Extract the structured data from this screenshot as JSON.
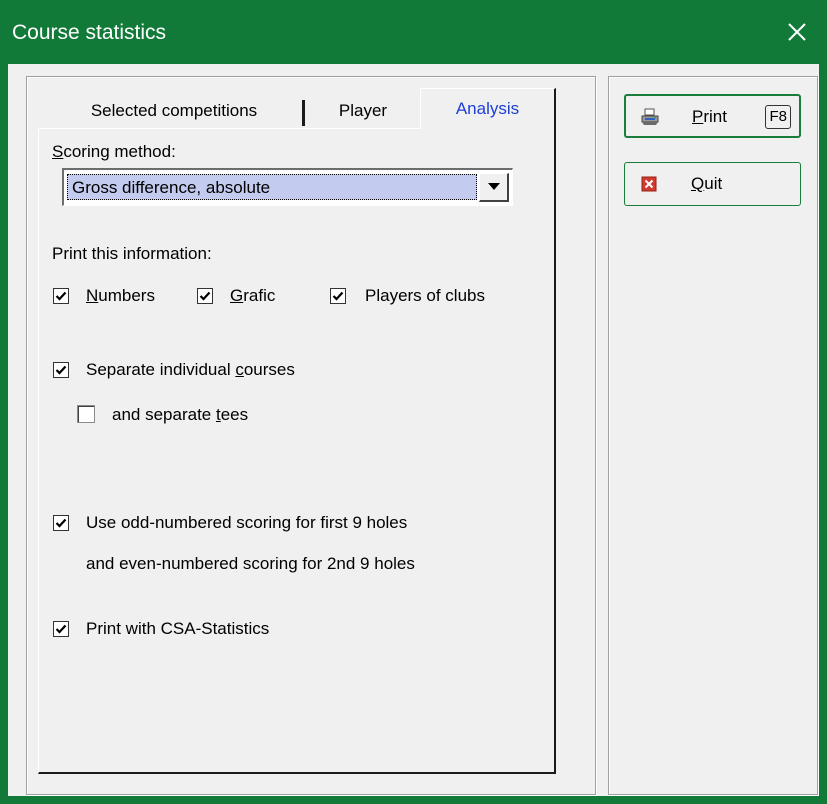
{
  "window": {
    "title": "Course statistics",
    "accent": "#117a38"
  },
  "tabs": {
    "selected_competitions": "Selected competitions",
    "player": "Player",
    "analysis": "Analysis"
  },
  "scoring": {
    "label_prefix": "",
    "label_mnemonic": "S",
    "label_rest": "coring method:",
    "selected_value": "Gross difference, absolute"
  },
  "print_info": {
    "heading": "Print this information:",
    "numbers": {
      "mnemonic": "N",
      "rest": "umbers",
      "checked": true
    },
    "grafic": {
      "mnemonic": "G",
      "rest": "rafic",
      "checked": true
    },
    "players_of_clubs": {
      "label": "Players of clubs",
      "checked": true
    }
  },
  "courses": {
    "separate_courses_pre": "Separate individual ",
    "separate_courses_mn": "c",
    "separate_courses_post": "ourses",
    "separate_courses_checked": true,
    "separate_tees_pre": "and separate ",
    "separate_tees_mn": "t",
    "separate_tees_post": "ees",
    "separate_tees_checked": false
  },
  "odd_even": {
    "line1": "Use odd-numbered scoring for first 9 holes",
    "line2": "and even-numbered scoring for 2nd 9 holes",
    "checked": true
  },
  "csa": {
    "label": "Print with CSA-Statistics",
    "checked": true
  },
  "buttons": {
    "print_mnemonic": "P",
    "print_rest": "rint",
    "print_shortcut": "F8",
    "quit_mnemonic": "Q",
    "quit_rest": "uit"
  },
  "icons": {
    "close": "close-icon",
    "printer": "printer-icon",
    "quit": "quit-icon",
    "dropdown": "chevron-down-icon"
  }
}
